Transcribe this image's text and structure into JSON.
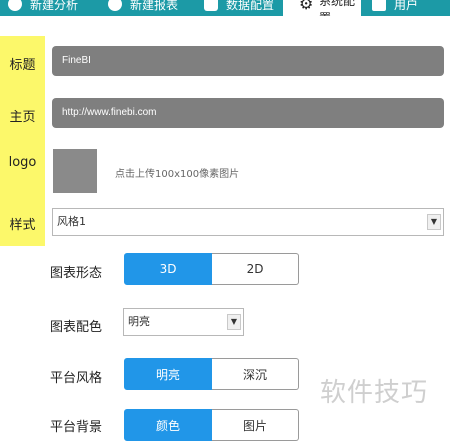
{
  "nav": {
    "tabs": [
      {
        "label": "新建分析",
        "icon": "info-icon"
      },
      {
        "label": "新建报表",
        "icon": "globe-icon"
      },
      {
        "label": "数据配置",
        "icon": "database-icon"
      },
      {
        "label": "系统配置",
        "icon": "gear-icon",
        "active": true
      },
      {
        "label": "用户",
        "icon": "user-icon"
      }
    ]
  },
  "form": {
    "title": {
      "label": "标题",
      "value": "FineBI"
    },
    "homepage": {
      "label": "主页",
      "value": "http://www.finebi.com"
    },
    "logo": {
      "label": "logo",
      "hint": "点击上传100x100像素图片"
    },
    "style": {
      "label": "样式",
      "value": "风格1"
    },
    "chart_form": {
      "label": "图表形态",
      "options": [
        "3D",
        "2D"
      ],
      "selected": "3D"
    },
    "chart_color": {
      "label": "图表配色",
      "value": "明亮"
    },
    "platform_style": {
      "label": "平台风格",
      "options": [
        "明亮",
        "深沉"
      ],
      "selected": "明亮"
    },
    "platform_bg": {
      "label": "平台背景",
      "options": [
        "颜色",
        "图片"
      ],
      "selected": "颜色"
    }
  },
  "watermark": "软件技巧",
  "colors": {
    "accent": "#2196e8",
    "highlight": "#fcf86a",
    "topbar": "#1c9aa6",
    "field": "#7f7f7f"
  }
}
